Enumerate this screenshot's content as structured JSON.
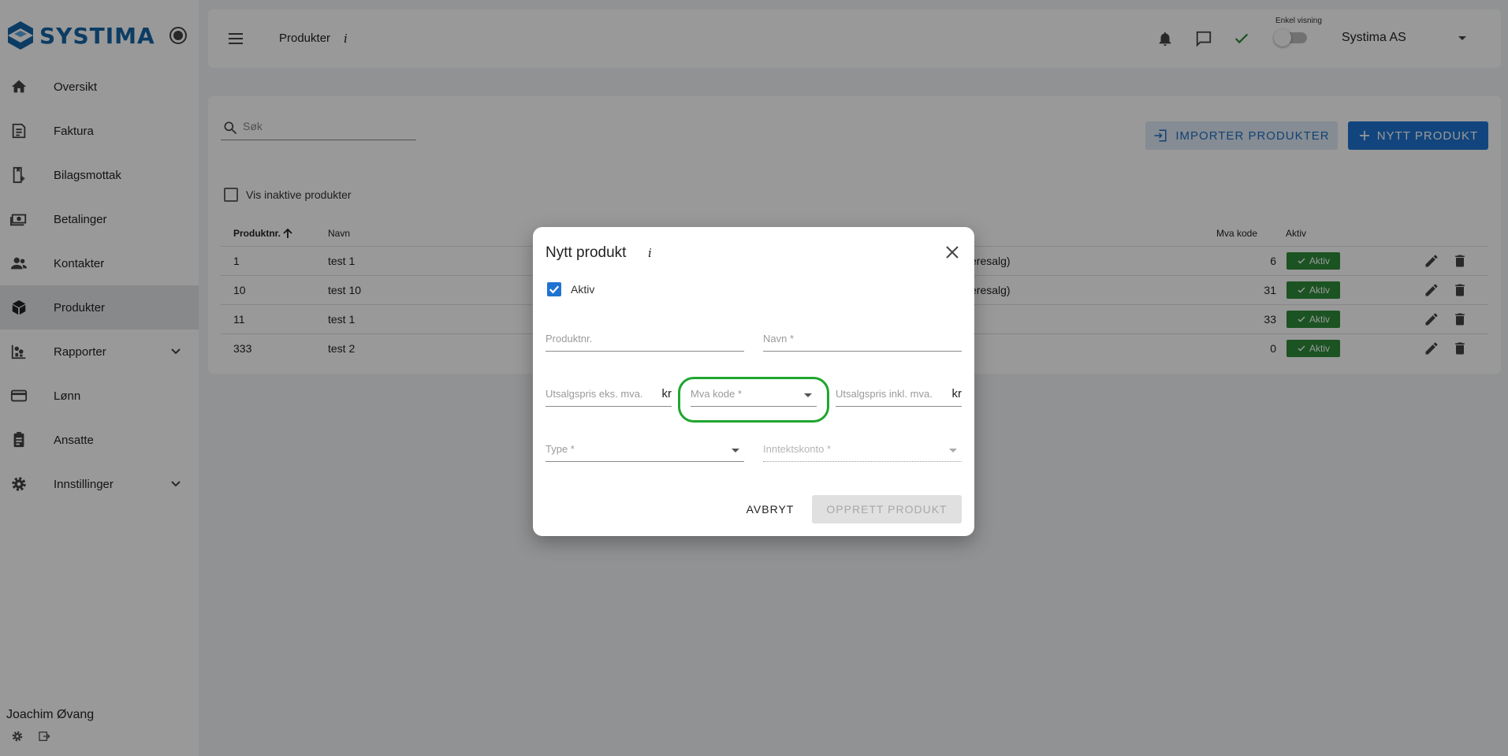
{
  "brand": {
    "name": "SYSTIMA",
    "color": "#1565a6"
  },
  "sidebar": {
    "items": [
      {
        "label": "Oversikt",
        "icon": "home-icon"
      },
      {
        "label": "Faktura",
        "icon": "invoice-icon"
      },
      {
        "label": "Bilagsmottak",
        "icon": "receipt-inbox-icon"
      },
      {
        "label": "Betalinger",
        "icon": "payments-icon"
      },
      {
        "label": "Kontakter",
        "icon": "contacts-icon"
      },
      {
        "label": "Produkter",
        "icon": "box-icon",
        "active": true
      },
      {
        "label": "Rapporter",
        "icon": "reports-icon",
        "expandable": true
      },
      {
        "label": "Lønn",
        "icon": "card-icon"
      },
      {
        "label": "Ansatte",
        "icon": "badge-icon"
      },
      {
        "label": "Innstillinger",
        "icon": "gear-icon",
        "expandable": true
      }
    ],
    "user": {
      "name": "Joachim Øvang"
    }
  },
  "header": {
    "title": "Produkter",
    "info": "i",
    "enkel_visning_label": "Enkel visning",
    "company": "Systima AS"
  },
  "toolbar": {
    "search_placeholder": "Søk",
    "import_label": "IMPORTER PRODUKTER",
    "new_label": "NYTT PRODUKT",
    "inactive_label": "Vis inaktive produkter"
  },
  "table": {
    "columns": {
      "produktnr": "Produktnr.",
      "navn": "Navn",
      "mva_kode": "Mva kode",
      "aktiv": "Aktiv"
    },
    "rows": [
      {
        "nr": "1",
        "navn": "test 1",
        "partial": "eresalg)",
        "mva": "6",
        "status": "Aktiv"
      },
      {
        "nr": "10",
        "navn": "test 10",
        "partial": "eresalg)",
        "mva": "31",
        "status": "Aktiv"
      },
      {
        "nr": "11",
        "navn": "test 1",
        "partial": "",
        "mva": "33",
        "status": "Aktiv"
      },
      {
        "nr": "333",
        "navn": "test 2",
        "partial": "",
        "mva": "0",
        "status": "Aktiv"
      }
    ]
  },
  "dialog": {
    "title": "Nytt produkt",
    "info": "i",
    "aktiv_label": "Aktiv",
    "aktiv_checked": true,
    "fields": {
      "produktnr": "Produktnr.",
      "navn": "Navn *",
      "pris_eks": "Utsalgspris eks. mva.",
      "pris_eks_suffix": "kr",
      "mva_kode": "Mva kode *",
      "pris_inkl": "Utsalgspris inkl. mva.",
      "pris_inkl_suffix": "kr",
      "type": "Type *",
      "inntektskonto": "Inntektskonto *"
    },
    "cancel_label": "AVBRYT",
    "create_label": "OPPRETT PRODUKT"
  },
  "colors": {
    "accent": "#1f73d0",
    "success": "#2e8b3a",
    "highlight": "#1fa52f"
  }
}
